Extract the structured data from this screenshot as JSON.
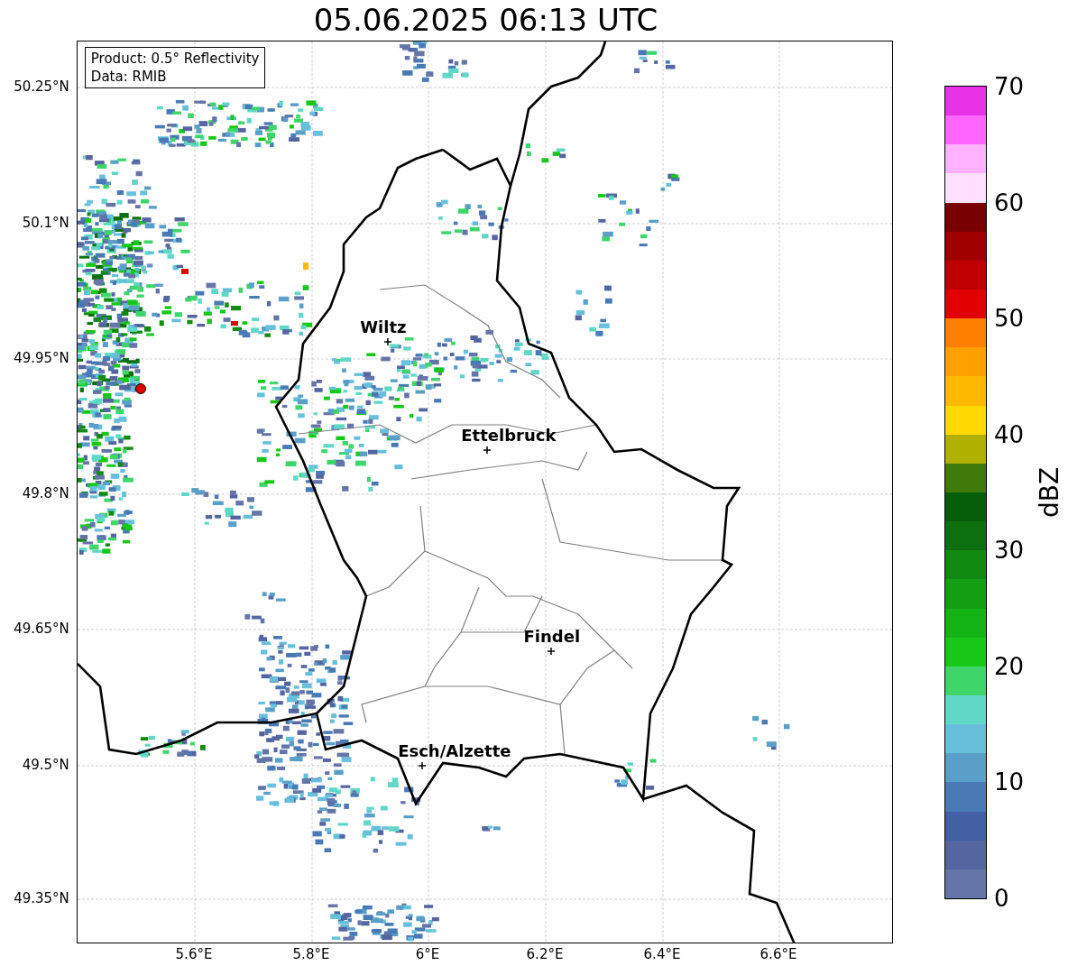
{
  "title": "05.06.2025 06:13 UTC",
  "legend": {
    "lines": [
      "Product: 0.5° Reflectivity",
      "Data: RMIB"
    ]
  },
  "map": {
    "lat_labels": [
      "50.25°N",
      "50.1°N",
      "49.95°N",
      "49.8°N",
      "49.65°N",
      "49.5°N",
      "49.35°N"
    ],
    "lon_labels": [
      "5.6°E",
      "5.8°E",
      "6°E",
      "6.2°E",
      "6.4°E",
      "6.6°E"
    ],
    "cities": [
      {
        "name": "Wiltz"
      },
      {
        "name": "Ettelbruck"
      },
      {
        "name": "Findel"
      },
      {
        "name": "Esch/Alzette"
      }
    ]
  },
  "colorbar": {
    "label": "dBZ",
    "ticks": [
      "70",
      "60",
      "50",
      "40",
      "30",
      "20",
      "10",
      "0"
    ],
    "bands": [
      {
        "color": "#e832e8"
      },
      {
        "color": "#ff66ff"
      },
      {
        "color": "#ffb2ff"
      },
      {
        "color": "#ffe0ff"
      },
      {
        "color": "#780000"
      },
      {
        "color": "#a00000"
      },
      {
        "color": "#c00000"
      },
      {
        "color": "#e00000"
      },
      {
        "color": "#ff7f00"
      },
      {
        "color": "#ff9f00"
      },
      {
        "color": "#ffb800"
      },
      {
        "color": "#ffd800"
      },
      {
        "color": "#b0b000"
      },
      {
        "color": "#407a0a"
      },
      {
        "color": "#065e0a"
      },
      {
        "color": "#0c7010"
      },
      {
        "color": "#108a10"
      },
      {
        "color": "#12a012"
      },
      {
        "color": "#14b414"
      },
      {
        "color": "#18c818"
      },
      {
        "color": "#3ed66a"
      },
      {
        "color": "#60d8c8"
      },
      {
        "color": "#66c0dc"
      },
      {
        "color": "#5a9fc8"
      },
      {
        "color": "#4a7ab5"
      },
      {
        "color": "#4460a5"
      },
      {
        "color": "#5565a0"
      },
      {
        "color": "#6675a8"
      }
    ]
  }
}
